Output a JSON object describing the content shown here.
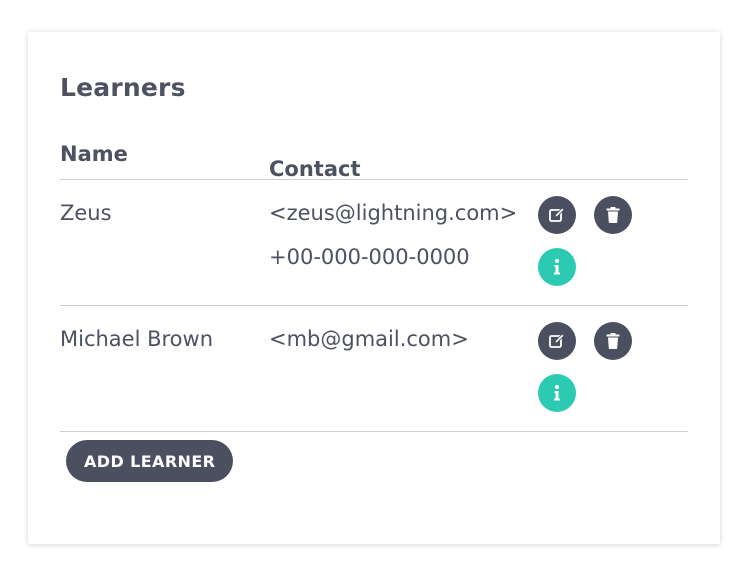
{
  "card": {
    "title": "Learners"
  },
  "table": {
    "headers": {
      "name": "Name",
      "contact": "Contact"
    },
    "rows": [
      {
        "name": "Zeus",
        "email": "<zeus@lightning.com>",
        "phone": "+00-000-000-0000"
      },
      {
        "name": "Michael Brown",
        "email": "<mb@gmail.com>",
        "phone": ""
      }
    ]
  },
  "actions": {
    "edit_icon": "edit-icon",
    "delete_icon": "trash-icon",
    "info_icon": "info-icon"
  },
  "footer": {
    "add_label": "ADD LEARNER"
  },
  "colors": {
    "dark": "#4b5060",
    "accent": "#2cc9b3",
    "text": "#4c5260",
    "divider": "#cfcfcf"
  }
}
